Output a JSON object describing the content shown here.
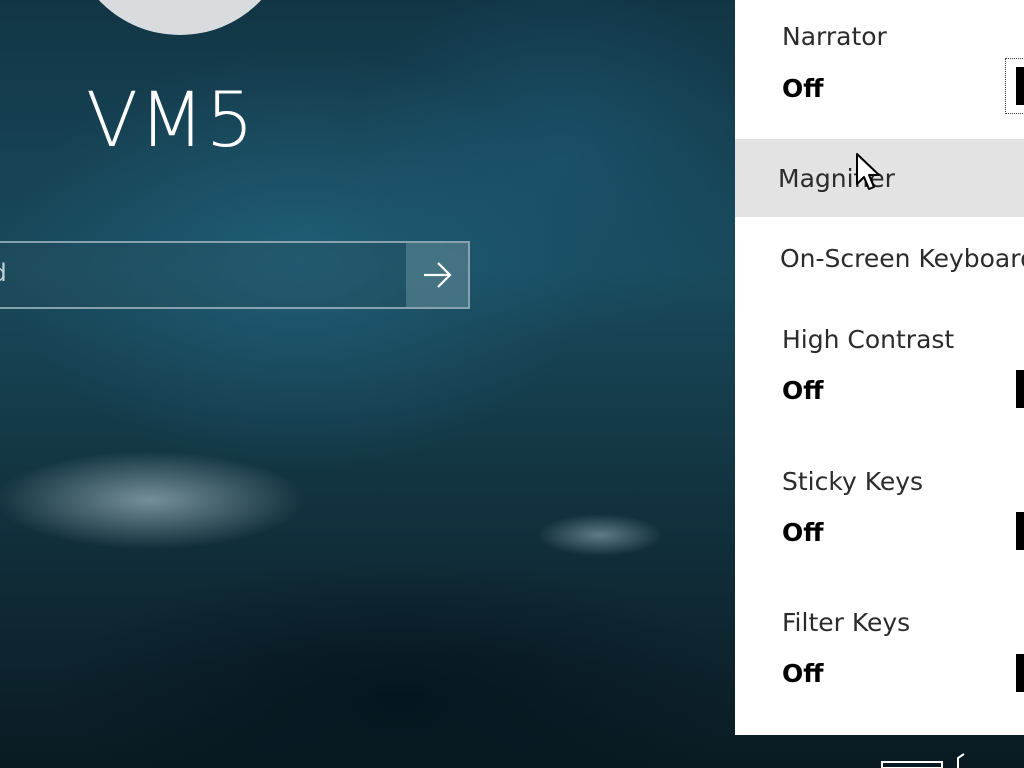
{
  "login": {
    "username": "VM5",
    "password_placeholder": "Password",
    "password_visible_text": "rd",
    "submit_icon": "arrow-right-icon"
  },
  "accessibility_menu": {
    "items": [
      {
        "label": "Narrator",
        "value": "Off",
        "has_toggle": true
      },
      {
        "label": "Magnifier",
        "value": null,
        "has_toggle": false,
        "hovered": true
      },
      {
        "label": "On-Screen Keyboard",
        "value": null,
        "has_toggle": false
      },
      {
        "label": "High Contrast",
        "value": "Off",
        "has_toggle": true
      },
      {
        "label": "Sticky Keys",
        "value": "Off",
        "has_toggle": true
      },
      {
        "label": "Filter Keys",
        "value": "Off",
        "has_toggle": true
      }
    ]
  },
  "colors": {
    "panel_bg": "#ffffff",
    "hover_bg": "#e3e3e3",
    "text_primary": "#2b2b2b",
    "value_text": "#000000"
  }
}
